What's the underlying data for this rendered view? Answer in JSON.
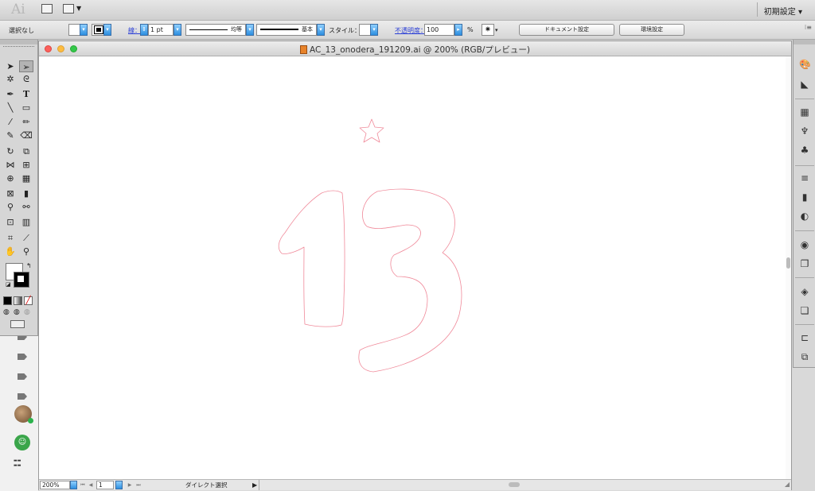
{
  "app": {
    "logo": "Ai",
    "workspace_label": "初期設定 ▾"
  },
  "control_bar": {
    "selection": "選択なし",
    "stroke_label": "線：",
    "stroke_weight": "1 pt",
    "profile_label": "均等",
    "brush_label": "基本",
    "style_label": "スタイル：",
    "opacity_label": "不透明度：",
    "opacity_value": "100",
    "opacity_unit": "%",
    "doc_setup_button": "ドキュメント設定",
    "preferences_button": "環境設定"
  },
  "document": {
    "title": "AC_13_onodera_191209.ai @ 200% (RGB/プレビュー)",
    "artwork_color": "#f08a9a"
  },
  "status_bar": {
    "zoom": "200%",
    "artboard": "1",
    "tool_name": "ダイレクト選択"
  }
}
